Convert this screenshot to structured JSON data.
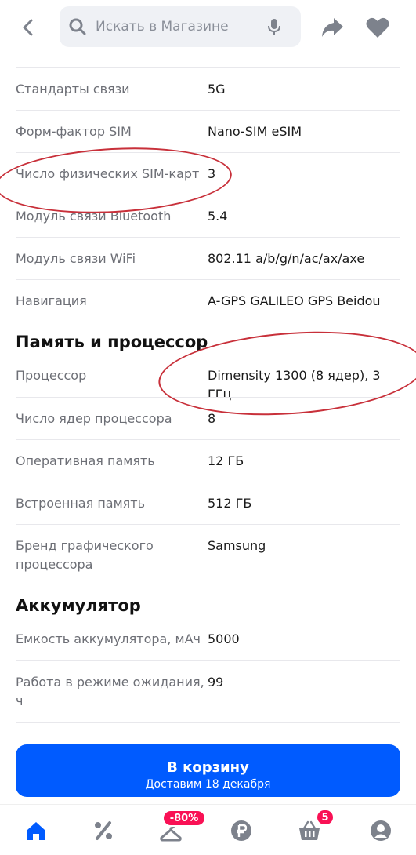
{
  "search": {
    "placeholder": "Искать в Магазине"
  },
  "specs_top": [
    {
      "label": "Стандарты связи",
      "value": "5G"
    },
    {
      "label": "Форм-фактор SIM",
      "value": "Nano-SIM eSIM"
    },
    {
      "label": "Число физических SIM-карт",
      "value": "3"
    },
    {
      "label": "Модуль связи Bluetooth",
      "value": "5.4"
    },
    {
      "label": "Модуль связи WiFi",
      "value": "802.11 a/b/g/n/ac/ax/axe"
    },
    {
      "label": "Навигация",
      "value": "A-GPS GALILEO GPS Beidou"
    }
  ],
  "section_memory": {
    "title": "Память и процессор"
  },
  "specs_memory": [
    {
      "label": "Процессор",
      "value": "Dimensity 1300 (8 ядер), 3 ГГц"
    },
    {
      "label": "Число ядер процессора",
      "value": "8"
    },
    {
      "label": "Оперативная память",
      "value": "12 ГБ"
    },
    {
      "label": "Встроенная память",
      "value": "512 ГБ"
    },
    {
      "label_line1": "Бренд графического",
      "label_line2": "процессора",
      "value": "Samsung"
    }
  ],
  "section_battery": {
    "title": "Аккумулятор"
  },
  "specs_battery": [
    {
      "label": "Емкость аккумулятора, мАч",
      "value": "5000"
    },
    {
      "label_line1": "Работа в режиме ожидания,",
      "label_line2": "ч",
      "value": "99"
    }
  ],
  "cart_button": {
    "label": "В корзину",
    "sublabel": "Доставим 18 декабря"
  },
  "bottom_nav": {
    "discount_badge": "-80%",
    "cart_badge": "5"
  },
  "colors": {
    "accent": "#005bff",
    "badge": "#f91155",
    "annotation": "#c8303a"
  }
}
